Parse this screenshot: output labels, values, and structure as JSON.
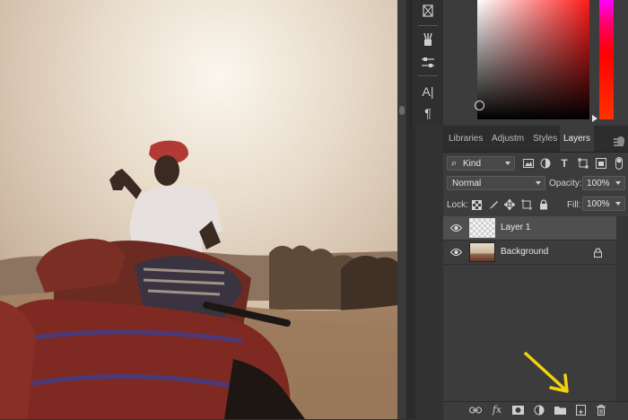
{
  "tools": {
    "items": [
      {
        "icon": "puppet-warp-icon"
      },
      {
        "icon": "brushes-icon"
      },
      {
        "icon": "adjust-sliders-icon"
      },
      {
        "icon": "character-icon",
        "glyph": "A|"
      },
      {
        "icon": "paragraph-icon",
        "glyph": "¶"
      }
    ]
  },
  "panel": {
    "tabs": [
      "Libraries",
      "Adjustm",
      "Styles",
      "Layers"
    ],
    "active_tab": "Layers",
    "filter": {
      "kind_label": "Kind"
    },
    "blend": {
      "mode": "Normal",
      "opacity_label": "Opacity:",
      "opacity_value": "100%"
    },
    "lock": {
      "label": "Lock:",
      "fill_label": "Fill:",
      "fill_value": "100%"
    },
    "layers": [
      {
        "name": "Layer 1",
        "selected": true,
        "visible": true
      },
      {
        "name": "Background",
        "selected": false,
        "visible": true,
        "locked": true
      }
    ]
  },
  "colors": {
    "panel_bg": "#3c3c3c",
    "selected_row": "#4f4f4f",
    "annotation_arrow": "#f2d40c"
  }
}
